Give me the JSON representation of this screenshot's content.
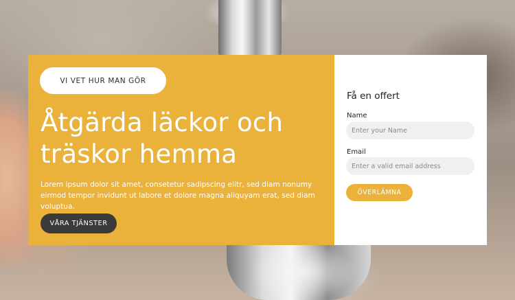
{
  "hero": {
    "badge_label": "VI VET HUR MAN GÖR",
    "heading": "Åtgärda läckor och träskor hemma",
    "body_text": "Lorem ipsum dolor sit amet, consetetur sadipscing elitr, sed diam nonumy eirmod tempor invidunt ut labore et dolore magna aliquyam erat, sed diam voluptua.",
    "cta_label": "VÅRA TJÄNSTER"
  },
  "form": {
    "title": "Få en offert",
    "name_label": "Name",
    "name_placeholder": "Enter your Name",
    "name_value": "",
    "email_label": "Email",
    "email_placeholder": "Enter a valid email address",
    "email_value": "",
    "submit_label": "ÖVERLÄMNA"
  },
  "colors": {
    "accent": "#eab23a",
    "dark_button": "#3a3a3a",
    "form_background": "#ffffff",
    "field_background": "#f0f0f0",
    "text_light": "#ffffff"
  }
}
